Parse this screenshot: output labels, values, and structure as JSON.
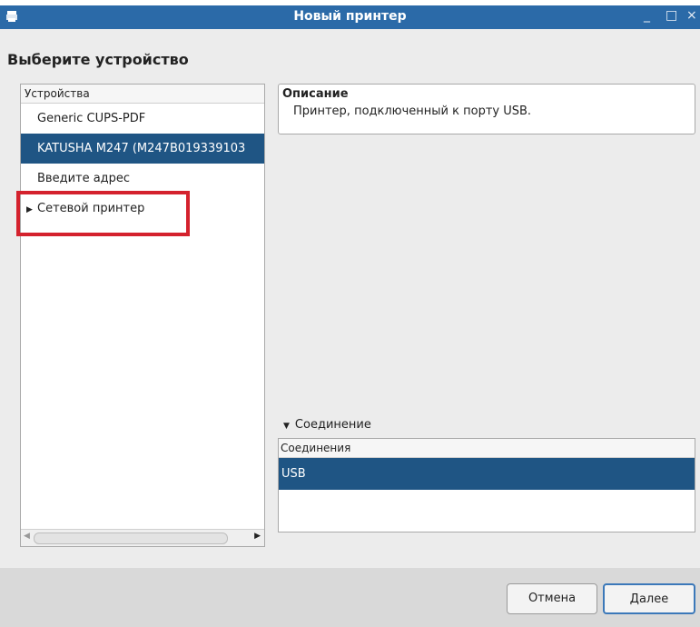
{
  "window": {
    "title": "Новый принтер",
    "minimize": "_",
    "maximize": "□",
    "close": "×"
  },
  "heading": "Выберите устройство",
  "devices": {
    "header": "Устройства",
    "items": [
      {
        "label": "Generic CUPS-PDF"
      },
      {
        "label": "KATUSHA M247 (M247B019339103"
      },
      {
        "label": "Введите адрес"
      },
      {
        "label": "Сетевой принтер"
      }
    ]
  },
  "description": {
    "header": "Описание",
    "text": "Принтер, подключенный к порту USB."
  },
  "connection": {
    "toggle_label": "Соединение",
    "header": "Соединения",
    "items": [
      "USB"
    ]
  },
  "buttons": {
    "cancel": "Отмена",
    "next": "Далее"
  },
  "colors": {
    "titlebar": "#2b6aa8",
    "selection": "#1f5584",
    "highlight_box": "#d4222d"
  }
}
